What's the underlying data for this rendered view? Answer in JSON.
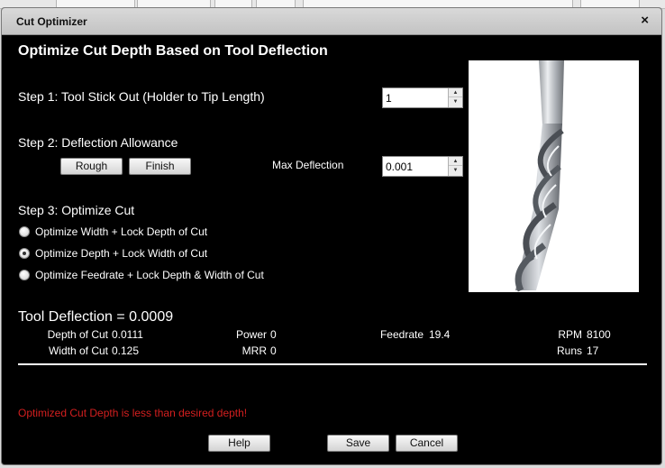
{
  "dialog": {
    "title": "Cut Optimizer",
    "close_glyph": "×",
    "heading": "Optimize Cut Depth Based on Tool Deflection"
  },
  "step1": {
    "label": "Step 1: Tool Stick Out (Holder to Tip Length)",
    "value": "1"
  },
  "step2": {
    "label": "Step 2: Deflection Allowance",
    "rough_label": "Rough",
    "finish_label": "Finish",
    "max_deflection_label": "Max Deflection",
    "max_deflection_value": "0.001"
  },
  "step3": {
    "label": "Step 3: Optimize Cut",
    "options": [
      {
        "label": "Optimize Width + Lock Depth of Cut",
        "checked": false
      },
      {
        "label": "Optimize Depth + Lock Width of Cut",
        "checked": true
      },
      {
        "label": "Optimize Feedrate + Lock Depth & Width of Cut",
        "checked": false
      }
    ]
  },
  "results": {
    "deflection": "Tool Deflection = 0.0009",
    "depth_of_cut_label": "Depth of Cut",
    "depth_of_cut_value": "0.0111",
    "width_of_cut_label": "Width of Cut",
    "width_of_cut_value": "0.125",
    "power_label": "Power",
    "power_value": "0",
    "mrr_label": "MRR",
    "mrr_value": "0",
    "feedrate_label": "Feedrate",
    "feedrate_value": "19.4",
    "rpm_label": "RPM",
    "rpm_value": "8100",
    "runs_label": "Runs",
    "runs_value": "17"
  },
  "warning": "Optimized Cut Depth is less than desired depth!",
  "footer": {
    "help_label": "Help",
    "save_label": "Save",
    "cancel_label": "Cancel"
  },
  "colors": {
    "dialog_bg": "#000000",
    "text": "#ffffff",
    "warning": "#d41f1f",
    "titlebar": "#c9c9c9"
  },
  "icons": {
    "close": "close-icon",
    "spin_up": "chevron-up-icon",
    "spin_down": "chevron-down-icon",
    "tool_image": "end-mill-image"
  }
}
